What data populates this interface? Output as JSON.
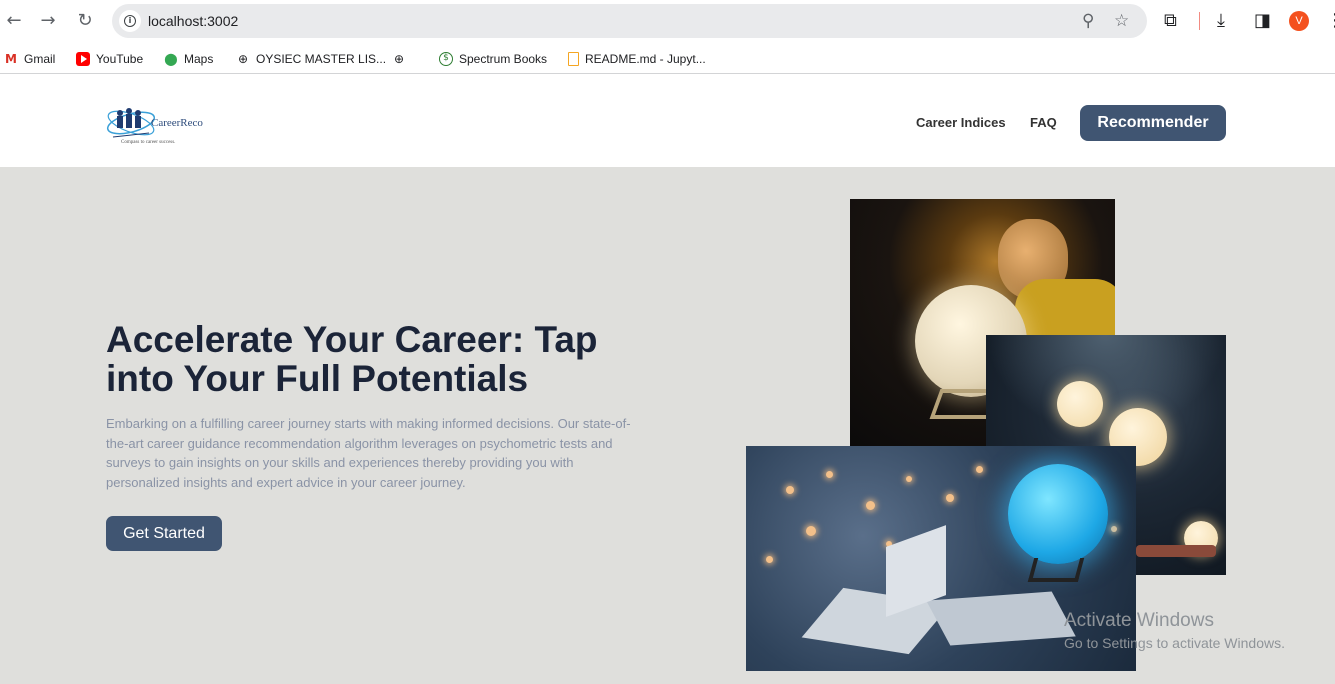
{
  "browser": {
    "url": "localhost:3002",
    "profile_initial": "V",
    "bookmarks": [
      {
        "label": "Gmail",
        "icon": "gmail-icon"
      },
      {
        "label": "YouTube",
        "icon": "youtube-icon"
      },
      {
        "label": "Maps",
        "icon": "maps-icon"
      },
      {
        "label": "OYSIEC MASTER LIS...",
        "icon": "globe-icon"
      },
      {
        "label": "",
        "icon": "globe-icon"
      },
      {
        "label": "Spectrum Books",
        "icon": "spectrum-icon"
      },
      {
        "label": "README.md - Jupyt...",
        "icon": "document-icon"
      }
    ]
  },
  "site": {
    "logo_text": "CareerReco",
    "logo_tagline": "Compass to career success.",
    "nav": {
      "career_indices": "Career Indices",
      "faq": "FAQ",
      "recommender": "Recommender"
    },
    "hero": {
      "title": "Accelerate Your Career: Tap into Your Full Potentials",
      "text": "Embarking on a fulfilling career journey starts with making informed decisions. Our state-of-the-art career guidance recommendation algorithm leverages on psychometric tests and surveys to gain insights on your skills and experiences thereby providing you with personalized insights and expert advice in your career journey.",
      "cta": "Get Started"
    }
  },
  "os_overlay": {
    "line1": "Activate Windows",
    "line2": "Go to Settings to activate Windows."
  },
  "colors": {
    "primary_button": "#405572",
    "hero_background": "#dfdfdc",
    "heading": "#1b2438",
    "body_text": "#8a93a6"
  }
}
